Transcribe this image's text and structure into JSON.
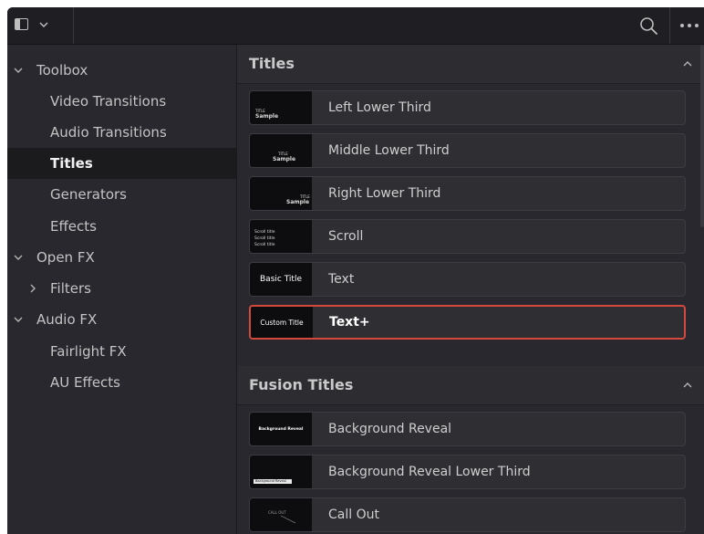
{
  "topbar": {
    "panel_icon": "sidebar-panel-icon",
    "dropdown_icon": "chevron-down-icon",
    "search_icon": "search-icon",
    "more_icon": "more-dots-icon"
  },
  "sidebar": {
    "items": [
      {
        "label": "Toolbox",
        "chevron": "down"
      },
      {
        "label": "Video Transitions",
        "chevron": ""
      },
      {
        "label": "Audio Transitions",
        "chevron": ""
      },
      {
        "label": "Titles",
        "chevron": "",
        "selected": true
      },
      {
        "label": "Generators",
        "chevron": ""
      },
      {
        "label": "Effects",
        "chevron": ""
      },
      {
        "label": "Open FX",
        "chevron": "down"
      },
      {
        "label": "Filters",
        "chevron": "right"
      },
      {
        "label": "Audio FX",
        "chevron": "down"
      },
      {
        "label": "Fairlight FX",
        "chevron": ""
      },
      {
        "label": "AU Effects",
        "chevron": ""
      }
    ]
  },
  "titles_section": {
    "title": "Titles",
    "items": [
      {
        "label": "Left Lower Third",
        "thumb_small": "TITLE",
        "thumb_main": "Sample"
      },
      {
        "label": "Middle Lower Third",
        "thumb_small": "TITLE",
        "thumb_main": "Sample"
      },
      {
        "label": "Right Lower Third",
        "thumb_small": "TITLE",
        "thumb_main": "Sample"
      },
      {
        "label": "Scroll",
        "thumb_lines": [
          "Scroll title",
          "Scroll title",
          "Scroll title"
        ]
      },
      {
        "label": "Text",
        "thumb_text": "Basic Title"
      },
      {
        "label": "Text+",
        "thumb_text": "Custom Title",
        "selected": true
      }
    ]
  },
  "fusion_section": {
    "title": "Fusion Titles",
    "items": [
      {
        "label": "Background Reveal",
        "thumb_text": "Background Reveal"
      },
      {
        "label": "Background Reveal Lower Third",
        "thumb_text": "Background Reveal"
      },
      {
        "label": "Call Out",
        "thumb_text": "CALL OUT"
      }
    ]
  },
  "colors": {
    "selection_border": "#d3493c",
    "panel_bg": "#28282e",
    "thumb_bg": "#0d0d0f"
  }
}
